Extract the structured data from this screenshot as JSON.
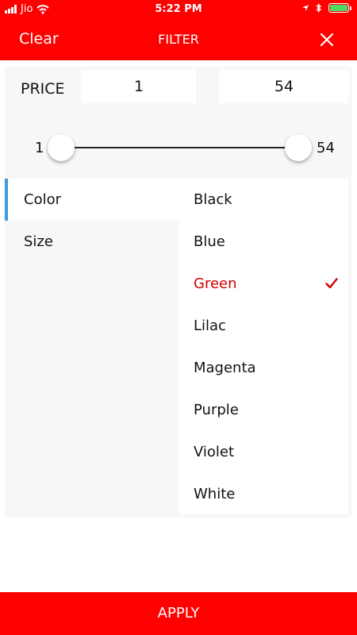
{
  "status_bar": {
    "carrier": "Jio",
    "time": "5:22 PM"
  },
  "nav": {
    "clear_label": "Clear",
    "title": "FILTER",
    "close_icon": "close-icon"
  },
  "price": {
    "label": "PRICE",
    "min_value": "1",
    "max_value": "54"
  },
  "slider": {
    "min_label": "1",
    "max_label": "54",
    "range_min": 1,
    "range_max": 54
  },
  "tabs": [
    {
      "label": "Color",
      "active": true
    },
    {
      "label": "Size",
      "active": false
    }
  ],
  "options": [
    {
      "label": "Black",
      "selected": false
    },
    {
      "label": "Blue",
      "selected": false
    },
    {
      "label": "Green",
      "selected": true
    },
    {
      "label": "Lilac",
      "selected": false
    },
    {
      "label": "Magenta",
      "selected": false
    },
    {
      "label": "Purple",
      "selected": false
    },
    {
      "label": "Violet",
      "selected": false
    },
    {
      "label": "White",
      "selected": false
    }
  ],
  "apply_label": "APPLY",
  "colors": {
    "brand_red": "#ff0000",
    "selected_text": "#d40000",
    "tab_indicator": "#3d9be0",
    "battery": "#4cd964"
  }
}
